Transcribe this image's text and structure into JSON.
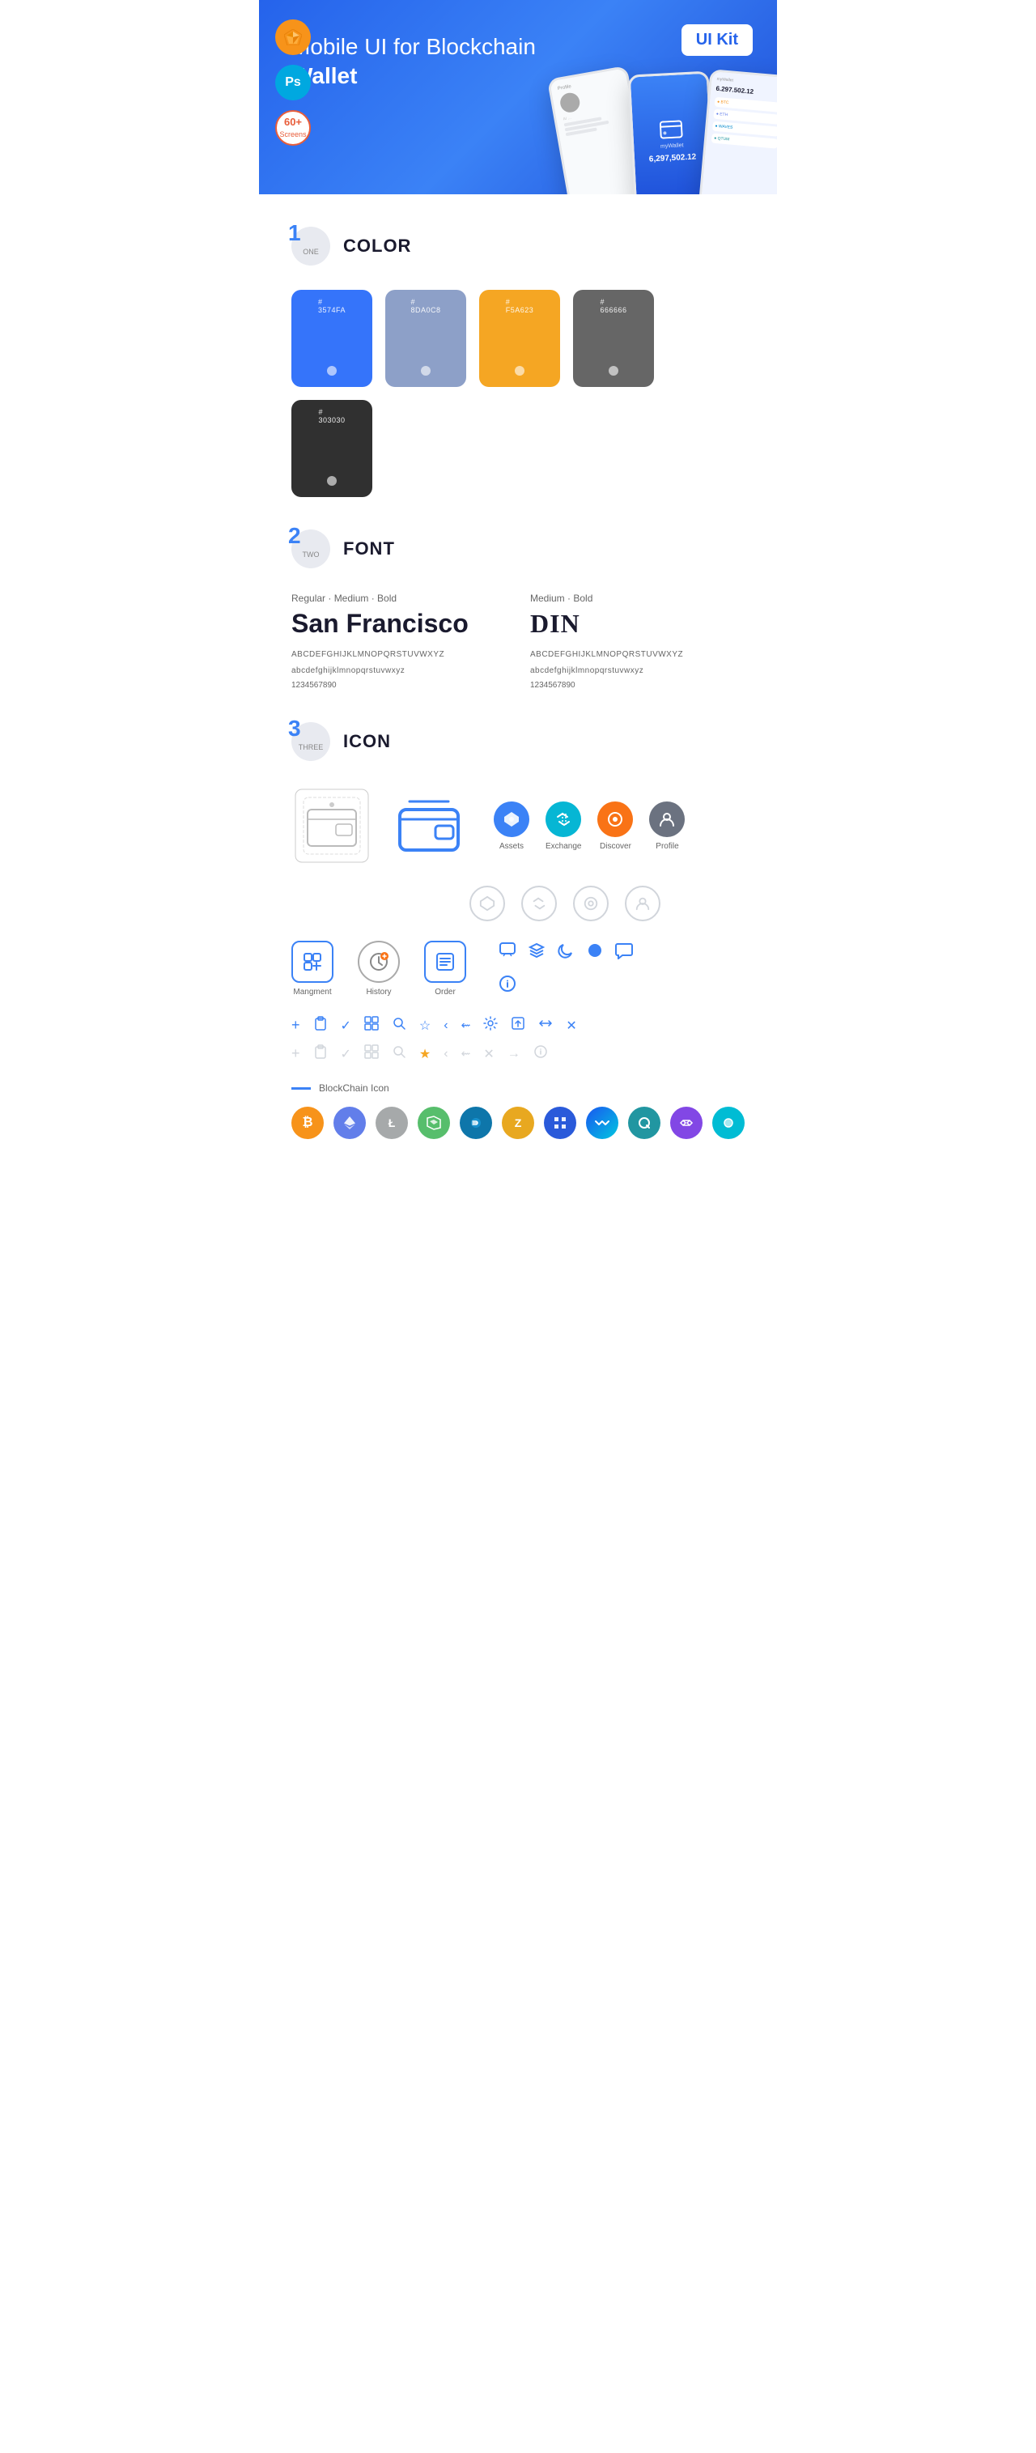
{
  "hero": {
    "title_part1": "Mobile UI for Blockchain ",
    "title_bold": "Wallet",
    "badge_label": "UI Kit",
    "badges": [
      {
        "id": "sketch",
        "label": "Sk",
        "type": "sketch"
      },
      {
        "id": "ps",
        "label": "Ps",
        "type": "ps"
      },
      {
        "id": "screens",
        "line1": "60+",
        "line2": "Screens",
        "type": "screens"
      }
    ]
  },
  "sections": {
    "color": {
      "number": "1",
      "sub": "ONE",
      "title": "COLOR",
      "swatches": [
        {
          "hex": "#3574FA",
          "code": "#\n3574FA",
          "bg": "#3574FA"
        },
        {
          "hex": "#8DA0C8",
          "code": "#\n8DA0C8",
          "bg": "#8DA0C8"
        },
        {
          "hex": "#F5A623",
          "code": "#\nF5A623",
          "bg": "#F5A623"
        },
        {
          "hex": "#666666",
          "code": "#\n666666",
          "bg": "#666666"
        },
        {
          "hex": "#303030",
          "code": "#\n303030",
          "bg": "#303030"
        }
      ]
    },
    "font": {
      "number": "2",
      "sub": "TWO",
      "title": "FONT",
      "fonts": [
        {
          "style_label": "Regular · Medium · Bold",
          "name": "San Francisco",
          "uppercase": "ABCDEFGHIJKLMNOPQRSTUVWXYZ",
          "lowercase": "abcdefghijklmnopqrstuvwxyz",
          "numbers": "1234567890"
        },
        {
          "style_label": "Medium · Bold",
          "name": "DIN",
          "uppercase": "ABCDEFGHIJKLMNOPQRSTUVWXYZ",
          "lowercase": "abcdefghijklmnopqrstuvwxyz",
          "numbers": "1234567890"
        }
      ]
    },
    "icon": {
      "number": "3",
      "sub": "THREE",
      "title": "ICON",
      "nav_icons": [
        {
          "label": "Assets",
          "type": "diamond-blue"
        },
        {
          "label": "Exchange",
          "type": "exchange-cyan"
        },
        {
          "label": "Discover",
          "type": "discover-orange"
        },
        {
          "label": "Profile",
          "type": "profile-gray"
        }
      ],
      "nav_icons_outline": [
        {
          "label": "",
          "type": "diamond-outline"
        },
        {
          "label": "",
          "type": "exchange-outline"
        },
        {
          "label": "",
          "type": "discover-outline"
        },
        {
          "label": "",
          "type": "profile-outline"
        }
      ],
      "app_icons": [
        {
          "label": "Mangment",
          "type": "management"
        },
        {
          "label": "History",
          "type": "history"
        },
        {
          "label": "Order",
          "type": "order"
        }
      ],
      "misc_icons_blue": [
        "chat",
        "layers",
        "moon",
        "circle",
        "chat-bubble",
        "info"
      ],
      "tool_icons": [
        "+",
        "📋",
        "✓",
        "⊞",
        "🔍",
        "☆",
        "<",
        "⇜",
        "⚙",
        "📤",
        "↔",
        "✕"
      ],
      "tool_icons_gray": [
        "+",
        "📋",
        "✓",
        "⊞",
        "🔍",
        "☆",
        "<",
        "⇜",
        "✕",
        "→",
        "ℹ"
      ],
      "blockchain_label": "BlockChain Icon",
      "crypto_icons": [
        {
          "symbol": "₿",
          "name": "Bitcoin",
          "class": "crypto-btc"
        },
        {
          "symbol": "Ξ",
          "name": "Ethereum",
          "class": "crypto-eth"
        },
        {
          "symbol": "Ł",
          "name": "Litecoin",
          "class": "crypto-ltc"
        },
        {
          "symbol": "N",
          "name": "Neo",
          "class": "crypto-neo"
        },
        {
          "symbol": "D",
          "name": "Dash",
          "class": "crypto-dash"
        },
        {
          "symbol": "Z",
          "name": "Zcash",
          "class": "crypto-zcash"
        },
        {
          "symbol": "◈",
          "name": "Grid",
          "class": "crypto-grid"
        },
        {
          "symbol": "W",
          "name": "Waves",
          "class": "crypto-waves"
        },
        {
          "symbol": "Q",
          "name": "Qtum",
          "class": "crypto-qtum"
        },
        {
          "symbol": "P",
          "name": "Matic",
          "class": "crypto-matic"
        },
        {
          "symbol": "S",
          "name": "Sky",
          "class": "crypto-sky"
        }
      ]
    }
  }
}
